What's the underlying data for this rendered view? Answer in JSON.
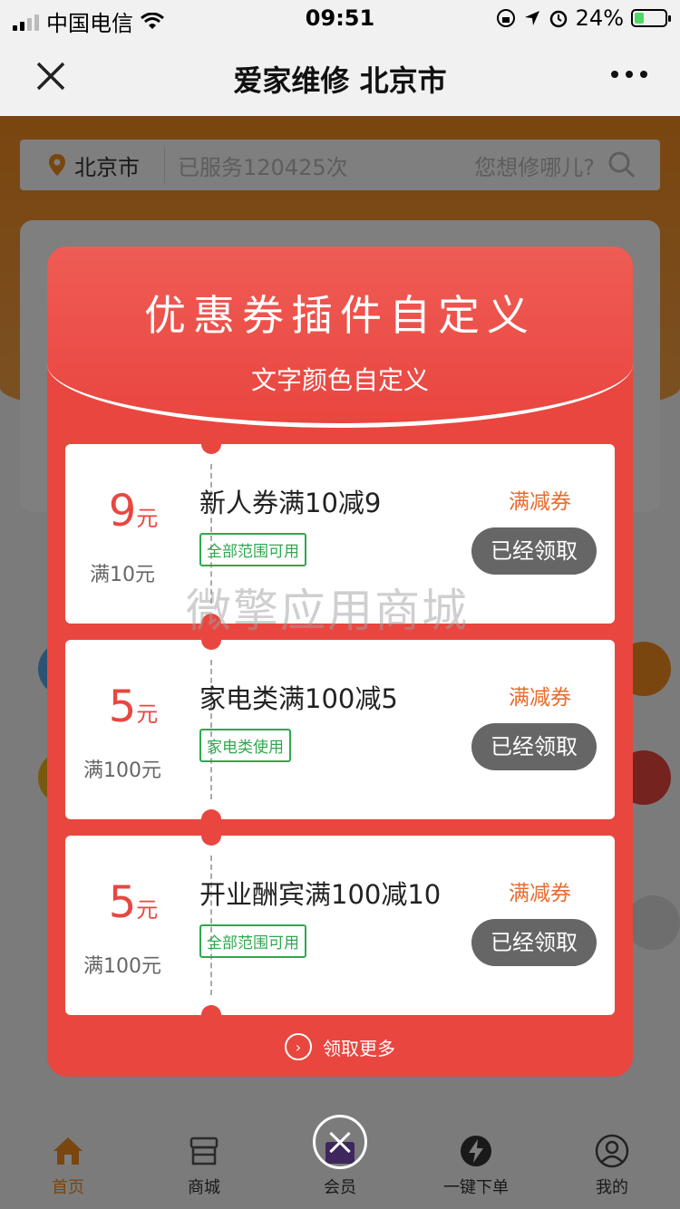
{
  "status_bar": {
    "carrier": "中国电信",
    "time": "09:51",
    "battery": "24%"
  },
  "navbar": {
    "title": "爱家维修 北京市"
  },
  "search": {
    "city": "北京市",
    "served": "已服务120425次",
    "placeholder": "您想修哪儿?"
  },
  "modal": {
    "title": "优惠券插件自定义",
    "subtitle": "文字颜色自定义",
    "coupons": [
      {
        "value": "9",
        "unit": "元",
        "condition": "满10元",
        "name": "新人券满10减9",
        "scope": "全部范围可用",
        "type": "满减券",
        "button": "已经领取"
      },
      {
        "value": "5",
        "unit": "元",
        "condition": "满100元",
        "name": "家电类满100减5",
        "scope": "家电类使用",
        "type": "满减券",
        "button": "已经领取"
      },
      {
        "value": "5",
        "unit": "元",
        "condition": "满100元",
        "name": "开业酬宾满100减10",
        "scope": "全部范围可用",
        "type": "满减券",
        "button": "已经领取"
      }
    ],
    "more": "领取更多"
  },
  "watermark": "微擎应用商城",
  "tabbar": {
    "items": [
      {
        "label": "首页",
        "icon": "home-icon"
      },
      {
        "label": "商城",
        "icon": "store-icon"
      },
      {
        "label": "会员",
        "icon": "member-icon"
      },
      {
        "label": "一键下单",
        "icon": "lightning-icon"
      },
      {
        "label": "我的",
        "icon": "user-icon"
      }
    ]
  },
  "colors": {
    "accent_orange": "#f28c1e",
    "modal_red": "#e9463f",
    "scope_green": "#2fa84f"
  }
}
